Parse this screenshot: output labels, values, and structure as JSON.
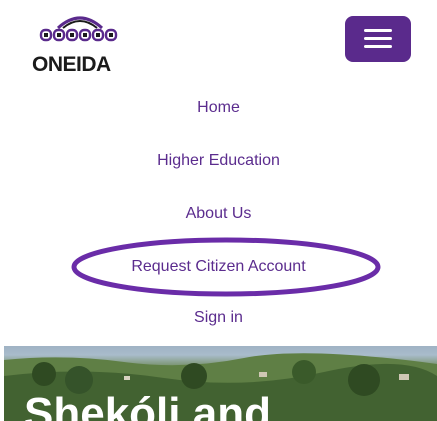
{
  "logo": {
    "text": "ONEIDA",
    "icon": "oneida-arch-logo-icon"
  },
  "menu_button": {
    "icon": "hamburger-menu-icon",
    "color": "#5a2a8c"
  },
  "nav": {
    "items": [
      {
        "label": "Home"
      },
      {
        "label": "Higher Education"
      },
      {
        "label": "About Us"
      },
      {
        "label": "Request Citizen Account"
      },
      {
        "label": "Sign in"
      }
    ],
    "link_color": "#5b2c8e",
    "highlight_color": "#6a2ca8"
  },
  "hero": {
    "title": "Shekóli and"
  }
}
